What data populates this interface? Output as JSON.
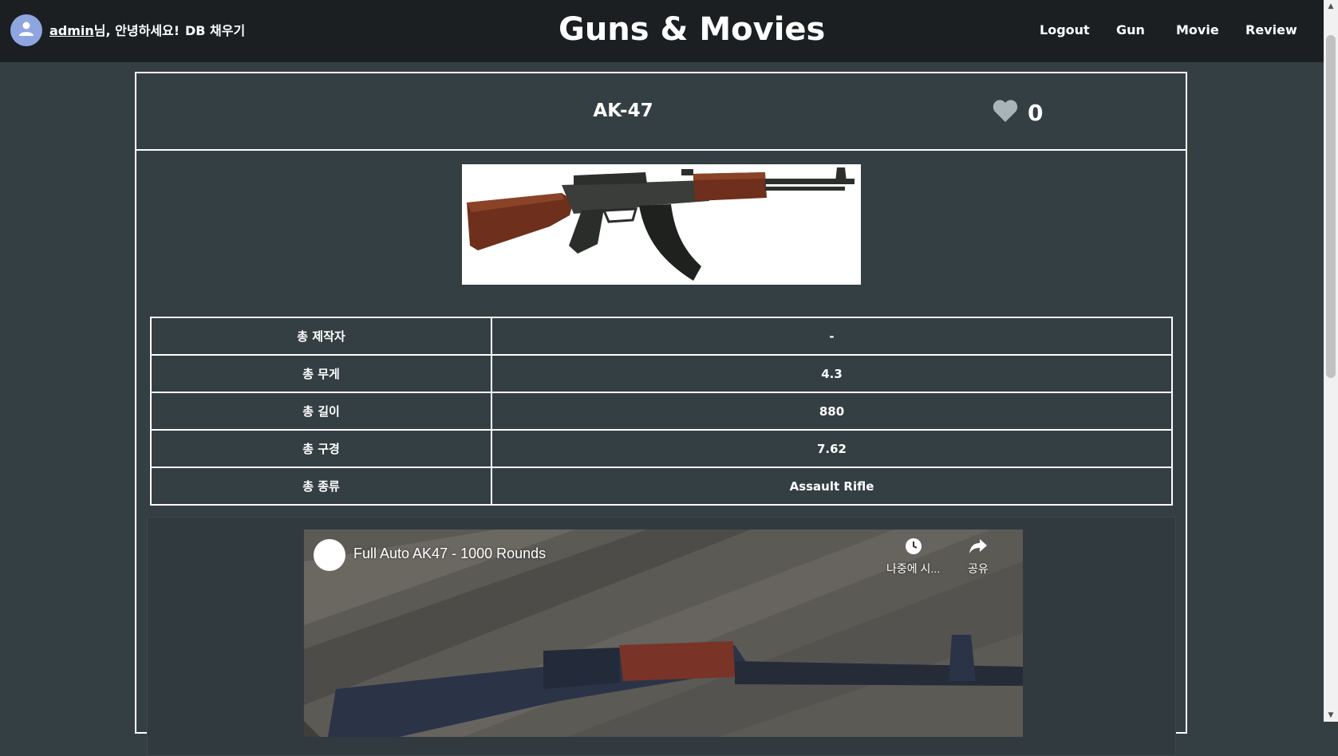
{
  "navbar": {
    "username": "admin",
    "greeting_suffix": "님, 안녕하세요!",
    "db_fill_label": "DB 채우기",
    "brand": "Guns & Movies",
    "links": {
      "logout": "Logout",
      "gun": "Gun",
      "movie": "Movie",
      "review": "Review"
    }
  },
  "gun": {
    "name": "AK-47",
    "likes": "0",
    "image_alt": "AK-47 rifle"
  },
  "specs": [
    {
      "label": "총 제작자",
      "value": "-"
    },
    {
      "label": "총 무게",
      "value": "4.3"
    },
    {
      "label": "총 길이",
      "value": "880"
    },
    {
      "label": "총 구경",
      "value": "7.62"
    },
    {
      "label": "총 종류",
      "value": "Assault Rifle"
    }
  ],
  "video": {
    "title": "Full Auto AK47 - 1000 Rounds",
    "watch_later_label": "나중에 시...",
    "share_label": "공유"
  },
  "colors": {
    "navbar_bg": "#1b1f22",
    "page_bg": "#343f43",
    "border": "#ffffff",
    "avatar": "#8ea5e0",
    "heart": "#a9b4b8"
  }
}
